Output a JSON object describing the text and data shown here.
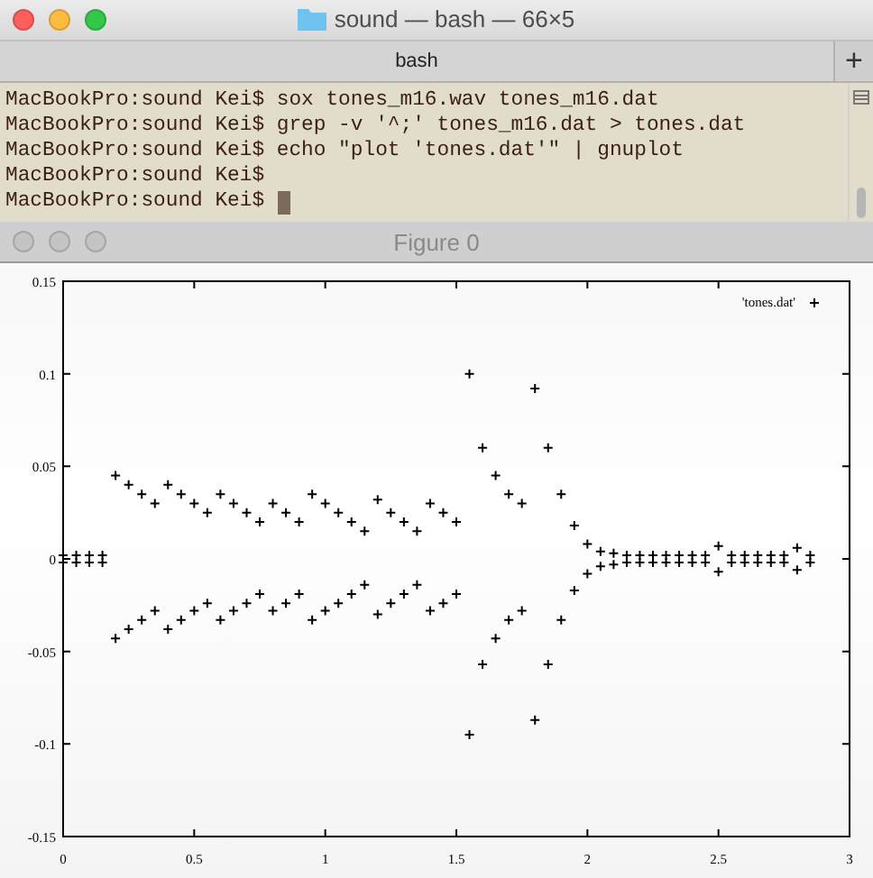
{
  "terminal": {
    "title": "sound — bash — 66×5",
    "tabs": [
      {
        "label": "bash",
        "selected": true
      }
    ],
    "new_tab_button": "+",
    "lines": [
      {
        "prompt": "MacBookPro:sound Kei$",
        "command": "sox tones_m16.wav tones_m16.dat"
      },
      {
        "prompt": "MacBookPro:sound Kei$",
        "command": "grep -v '^;' tones_m16.dat > tones.dat"
      },
      {
        "prompt": "MacBookPro:sound Kei$",
        "command": "echo \"plot 'tones.dat'\" | gnuplot"
      },
      {
        "prompt": "MacBookPro:sound Kei$"
      },
      {
        "prompt": "MacBookPro:sound Kei$",
        "cursor": true
      }
    ]
  },
  "figure": {
    "title": "Figure 0",
    "chart_data": {
      "type": "scatter",
      "xlim": [
        0,
        3
      ],
      "ylim": [
        -0.15,
        0.15
      ],
      "xticks": [
        {
          "value": 0,
          "label": "0"
        },
        {
          "value": 0.5,
          "label": "0.5"
        },
        {
          "value": 1,
          "label": "1"
        },
        {
          "value": 1.5,
          "label": "1.5"
        },
        {
          "value": 2,
          "label": "2"
        },
        {
          "value": 2.5,
          "label": "2.5"
        },
        {
          "value": 3,
          "label": "3"
        }
      ],
      "yticks": [
        {
          "value": 0.15,
          "label": "0.15"
        },
        {
          "value": 0.1,
          "label": "0.1"
        },
        {
          "value": 0.05,
          "label": "0.05"
        },
        {
          "value": 0,
          "label": "0"
        },
        {
          "value": -0.05,
          "label": "-0.05"
        },
        {
          "value": -0.1,
          "label": "-0.1"
        },
        {
          "value": -0.15,
          "label": "-0.15"
        }
      ],
      "x": [
        0,
        0,
        0.05,
        0.05,
        0.1,
        0.1,
        0.15,
        0.15,
        0.2,
        0.2,
        0.25,
        0.25,
        0.3,
        0.3,
        0.35,
        0.35,
        0.4,
        0.4,
        0.45,
        0.45,
        0.5,
        0.5,
        0.55,
        0.55,
        0.6,
        0.6,
        0.65,
        0.65,
        0.7,
        0.7,
        0.75,
        0.75,
        0.8,
        0.8,
        0.85,
        0.85,
        0.9,
        0.9,
        0.95,
        0.95,
        1.0,
        1.0,
        1.05,
        1.05,
        1.1,
        1.1,
        1.15,
        1.15,
        1.2,
        1.2,
        1.25,
        1.25,
        1.3,
        1.3,
        1.35,
        1.35,
        1.4,
        1.4,
        1.45,
        1.45,
        1.5,
        1.5,
        1.55,
        1.55,
        1.6,
        1.6,
        1.65,
        1.65,
        1.7,
        1.7,
        1.75,
        1.75,
        1.8,
        1.8,
        1.85,
        1.85,
        1.9,
        1.9,
        1.95,
        1.95,
        2.0,
        2.0,
        2.05,
        2.05,
        2.1,
        2.1,
        2.15,
        2.15,
        2.2,
        2.2,
        2.25,
        2.25,
        2.3,
        2.3,
        2.35,
        2.35,
        2.4,
        2.4,
        2.45,
        2.45,
        2.5,
        2.5,
        2.55,
        2.55,
        2.6,
        2.6,
        2.65,
        2.65,
        2.7,
        2.7,
        2.75,
        2.75,
        2.8,
        2.8,
        2.85,
        2.85
      ],
      "series": [
        {
          "name": "'tones.dat'",
          "color": "#000000",
          "values": [
            0.002,
            -0.002,
            0.002,
            -0.002,
            0.002,
            -0.002,
            0.002,
            -0.002,
            0.045,
            -0.043,
            0.04,
            -0.038,
            0.035,
            -0.033,
            0.03,
            -0.028,
            0.04,
            -0.038,
            0.035,
            -0.033,
            0.03,
            -0.028,
            0.025,
            -0.024,
            0.035,
            -0.033,
            0.03,
            -0.028,
            0.025,
            -0.024,
            0.02,
            -0.019,
            0.03,
            -0.028,
            0.025,
            -0.024,
            0.02,
            -0.019,
            0.035,
            -0.033,
            0.03,
            -0.028,
            0.025,
            -0.024,
            0.02,
            -0.019,
            0.015,
            -0.014,
            0.032,
            -0.03,
            0.025,
            -0.024,
            0.02,
            -0.019,
            0.015,
            -0.014,
            0.03,
            -0.028,
            0.025,
            -0.024,
            0.02,
            -0.019,
            0.1,
            -0.095,
            0.06,
            -0.057,
            0.045,
            -0.043,
            0.035,
            -0.033,
            0.03,
            -0.028,
            0.092,
            -0.087,
            0.06,
            -0.057,
            0.035,
            -0.033,
            0.018,
            -0.017,
            0.008,
            -0.008,
            0.004,
            -0.004,
            0.003,
            -0.003,
            0.002,
            -0.002,
            0.002,
            -0.002,
            0.002,
            -0.002,
            0.002,
            -0.002,
            0.002,
            -0.002,
            0.002,
            -0.002,
            0.002,
            -0.002,
            0.007,
            -0.007,
            0.002,
            -0.002,
            0.002,
            -0.002,
            0.002,
            -0.002,
            0.002,
            -0.002,
            0.002,
            -0.002,
            0.006,
            -0.006,
            0.002,
            -0.002
          ]
        }
      ]
    }
  }
}
